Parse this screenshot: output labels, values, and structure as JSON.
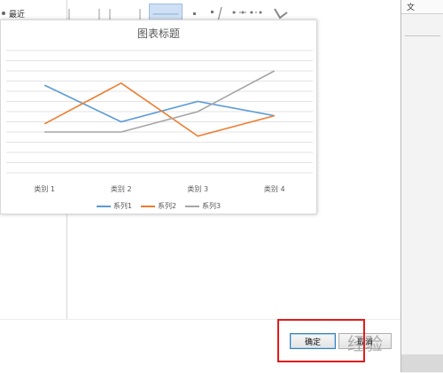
{
  "sidebar": {
    "recent_label": "最近"
  },
  "chart_data": {
    "type": "line",
    "title": "图表标题",
    "categories": [
      "类别 1",
      "类别 2",
      "类别 3",
      "类别 4"
    ],
    "series": [
      {
        "name": "系列1",
        "color": "#5b9bd5",
        "values": [
          4.3,
          2.5,
          3.5,
          2.8
        ]
      },
      {
        "name": "系列2",
        "color": "#ed7d31",
        "values": [
          2.4,
          4.4,
          1.8,
          2.8
        ]
      },
      {
        "name": "系列3",
        "color": "#a5a5a5",
        "values": [
          2,
          2,
          3,
          5
        ]
      }
    ],
    "ylim": [
      0,
      6
    ],
    "grid": true,
    "legend_position": "bottom"
  },
  "buttons": {
    "ok_label": "确定",
    "cancel_label": "取消"
  },
  "right_panel": {
    "label": "文"
  },
  "watermark": "经验"
}
